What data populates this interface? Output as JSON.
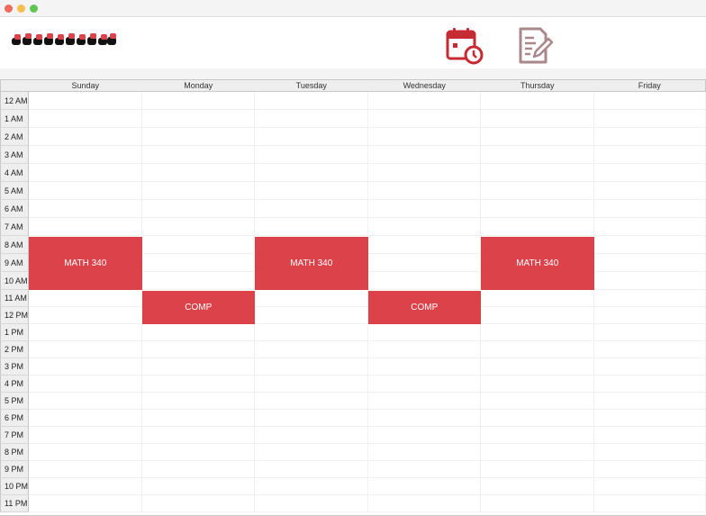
{
  "colors": {
    "accent": "#db4249",
    "titlebar": "#f5f4f4",
    "header_bg": "#eeeeee"
  },
  "header": {
    "calendar_icon": "calendar-clock-icon",
    "notes_icon": "notes-edit-icon"
  },
  "days": [
    "Sunday",
    "Monday",
    "Tuesday",
    "Wednesday",
    "Thursday",
    "Friday"
  ],
  "times": [
    "12 AM",
    "1 AM",
    "2 AM",
    "3 AM",
    "4 AM",
    "5 AM",
    "6 AM",
    "7 AM",
    "8 AM",
    "9 AM",
    "10 AM",
    "11 AM",
    "12 PM",
    "1 PM",
    "2 PM",
    "3 PM",
    "4 PM",
    "5 PM",
    "6 PM",
    "7 PM",
    "8 PM",
    "9 PM",
    "10 PM",
    "11 PM"
  ],
  "events": [
    {
      "title": "MATH 340",
      "day": "Sunday",
      "start": "8 AM",
      "end": "11 AM"
    },
    {
      "title": "MATH 340",
      "day": "Tuesday",
      "start": "8 AM",
      "end": "11 AM"
    },
    {
      "title": "MATH 340",
      "day": "Thursday",
      "start": "8 AM",
      "end": "11 AM"
    },
    {
      "title": "COMP",
      "day": "Monday",
      "start": "11 AM",
      "end": "1 PM"
    },
    {
      "title": "COMP",
      "day": "Wednesday",
      "start": "11 AM",
      "end": "1 PM"
    }
  ]
}
